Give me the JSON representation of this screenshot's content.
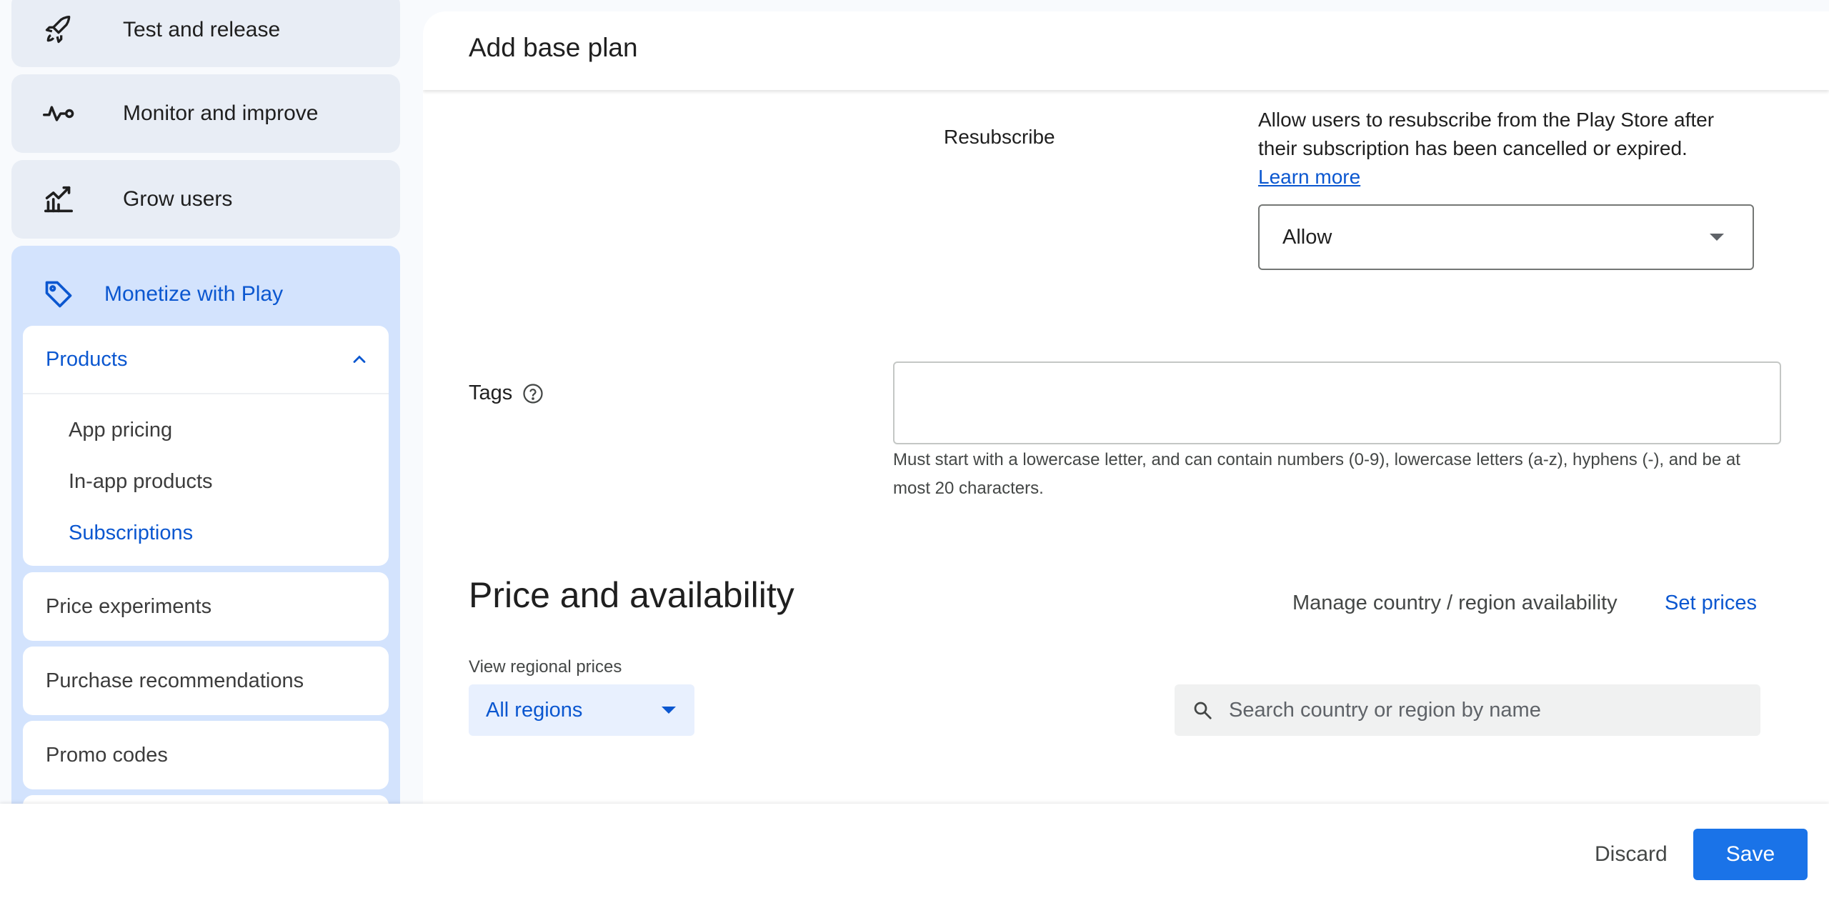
{
  "sidebar": {
    "items": [
      {
        "label": "Test and release",
        "icon": "rocket-icon"
      },
      {
        "label": "Monitor and improve",
        "icon": "vitals-icon"
      },
      {
        "label": "Grow users",
        "icon": "growth-chart-icon"
      }
    ],
    "monetize": {
      "label": "Monetize with Play",
      "icon": "tag-icon",
      "products": {
        "label": "Products",
        "icon": "chevron-up-icon",
        "children": [
          "App pricing",
          "In-app products",
          "Subscriptions"
        ],
        "active_child": "Subscriptions"
      },
      "cards": [
        "Price experiments",
        "Purchase recommendations",
        "Promo codes"
      ]
    }
  },
  "header": {
    "title": "Add base plan"
  },
  "resubscribe": {
    "label": "Resubscribe",
    "description": "Allow users to resubscribe from the Play Store after their subscription has been cancelled or expired.",
    "learn_more": "Learn more",
    "selected": "Allow"
  },
  "tags": {
    "label": "Tags",
    "value": "",
    "hint": "Must start with a lowercase letter, and can contain numbers (0-9), lowercase letters (a-z), hyphens (-), and be at most 20 characters."
  },
  "pricing": {
    "title": "Price and availability",
    "manage_link": "Manage country / region availability",
    "set_prices": "Set prices",
    "view_label": "View regional prices",
    "regions_selected": "All regions",
    "search_placeholder": "Search country or region by name"
  },
  "footer": {
    "discard": "Discard",
    "save": "Save"
  },
  "colors": {
    "accent": "#0b57d0",
    "primary_button": "#1a73e8",
    "sidebar_active_bg": "#d3e3fd",
    "sidebar_bg": "#e8edf5"
  }
}
